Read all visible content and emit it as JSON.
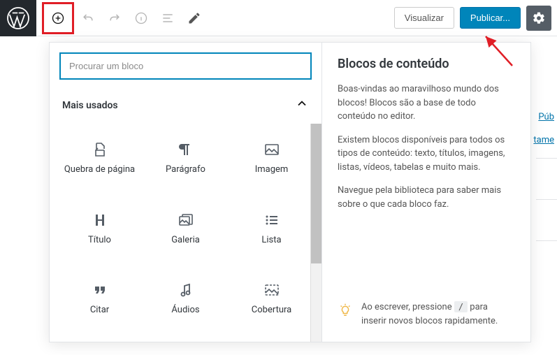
{
  "toolbar": {
    "preview_label": "Visualizar",
    "publish_label": "Publicar...",
    "add_block_aria": "Adicionar bloco"
  },
  "inserter": {
    "search_placeholder": "Procurar um bloco",
    "category_title": "Mais usados",
    "blocks": [
      {
        "name": "page-break",
        "label": "Quebra de página"
      },
      {
        "name": "paragraph",
        "label": "Parágrafo"
      },
      {
        "name": "image",
        "label": "Imagem"
      },
      {
        "name": "heading",
        "label": "Título"
      },
      {
        "name": "gallery",
        "label": "Galeria"
      },
      {
        "name": "list",
        "label": "Lista"
      },
      {
        "name": "quote",
        "label": "Citar"
      },
      {
        "name": "audio",
        "label": "Áudios"
      },
      {
        "name": "cover",
        "label": "Cobertura"
      }
    ]
  },
  "info": {
    "title": "Blocos de conteúdo",
    "p1": "Boas-vindas ao maravilhoso mundo dos blocos! Blocos são a base de todo conteúdo no editor.",
    "p2": "Existem blocos disponíveis para todos os tipos de conteúdo: texto, títulos, imagens, listas, vídeos, tabelas e muito mais.",
    "p3": "Navegue pela biblioteca para saber mais sobre o que cada bloco faz.",
    "tip_pre": "Ao escrever, pressione ",
    "tip_key": "/",
    "tip_post": " para inserir novos blocos rapidamente."
  },
  "sidebar_peek": {
    "link1": "Púb",
    "link2": "tame"
  }
}
